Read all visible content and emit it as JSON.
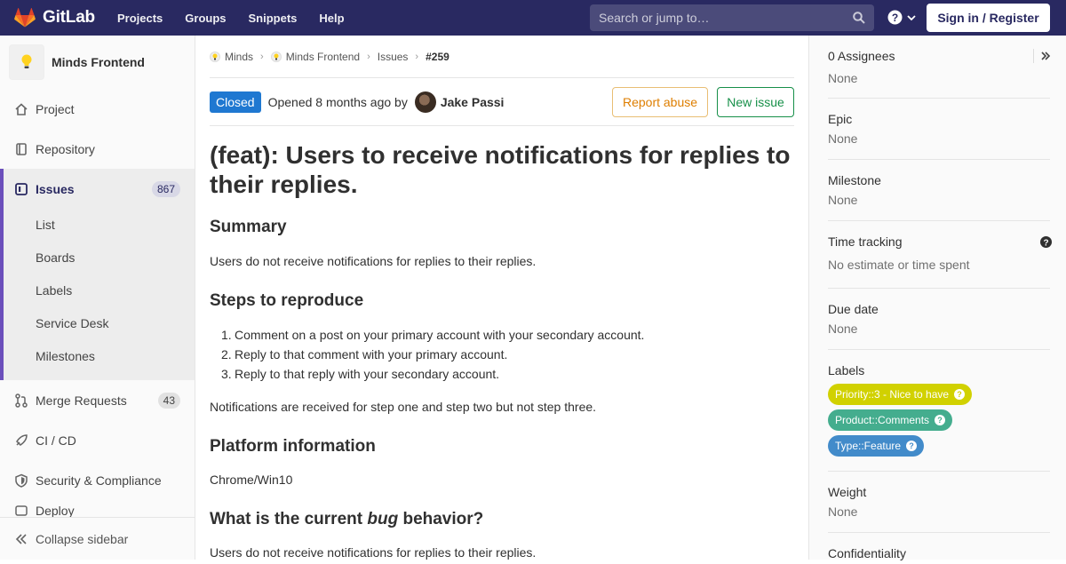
{
  "topnav": {
    "brand": "GitLab",
    "links": [
      "Projects",
      "Groups",
      "Snippets",
      "Help"
    ],
    "search_placeholder": "Search or jump to…",
    "signin": "Sign in / Register"
  },
  "sidebar": {
    "project_name": "Minds Frontend",
    "project": "Project",
    "repository": "Repository",
    "issues": {
      "label": "Issues",
      "count": "867",
      "sub": [
        "List",
        "Boards",
        "Labels",
        "Service Desk",
        "Milestones"
      ]
    },
    "merge_requests": {
      "label": "Merge Requests",
      "count": "43"
    },
    "cicd": "CI / CD",
    "security": "Security & Compliance",
    "partial": "Deploy",
    "collapse": "Collapse sidebar"
  },
  "breadcrumb": [
    "Minds",
    "Minds Frontend",
    "Issues",
    "#259"
  ],
  "issue": {
    "status": "Closed",
    "opened": "Opened 8 months ago by",
    "author": "Jake Passi",
    "report_abuse": "Report abuse",
    "new_issue": "New issue",
    "title": "(feat): Users to receive notifications for replies to their replies.",
    "summary_h": "Summary",
    "summary": "Users do not receive notifications for replies to their replies.",
    "steps_h": "Steps to reproduce",
    "steps": [
      "Comment on a post on your primary account with your secondary account.",
      "Reply to that comment with your primary account.",
      "Reply to that reply with your secondary account."
    ],
    "steps_note": "Notifications are received for step one and step two but not step three.",
    "platform_h": "Platform information",
    "platform": "Chrome/Win10",
    "current_h_pre": "What is the current ",
    "current_h_em": "bug",
    "current_h_post": " behavior?",
    "current": "Users do not receive notifications for replies to their replies."
  },
  "right_sidebar": {
    "assignees_title": "0 Assignees",
    "assignees_value": "None",
    "epic_title": "Epic",
    "epic_value": "None",
    "milestone_title": "Milestone",
    "milestone_value": "None",
    "time_title": "Time tracking",
    "time_value": "No estimate or time spent",
    "due_title": "Due date",
    "due_value": "None",
    "labels_title": "Labels",
    "labels": [
      {
        "text": "Priority::3 - Nice to have",
        "color": "#d1d100"
      },
      {
        "text": "Product::Comments",
        "color": "#44ad8e"
      },
      {
        "text": "Type::Feature",
        "color": "#428bca"
      }
    ],
    "weight_title": "Weight",
    "weight_value": "None",
    "confidentiality_title": "Confidentiality"
  }
}
